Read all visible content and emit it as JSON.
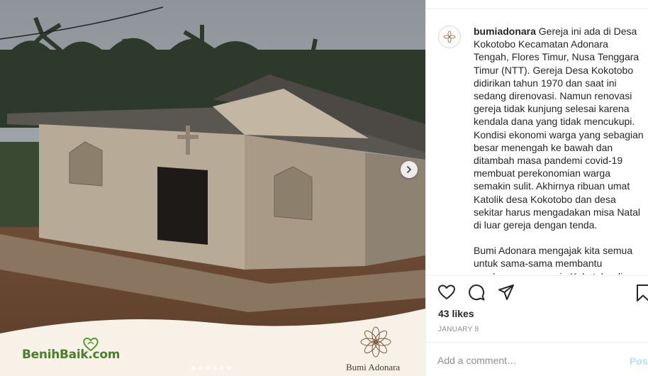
{
  "post": {
    "username": "bumiadonara",
    "caption_p1": "Gereja ini ada di Desa Kokotobo Kecamatan Adonara Tengah, Flores Timur, Nusa Tenggara Timur (NTT). Gereja Desa Kokotobo didirikan tahun 1970 dan saat ini sedang direnovasi. Namun renovasi gereja tidak kunjung selesai karena kendala dana yang tidak mencukupi. Kondisi ekonomi warga yang sebagian besar menengah ke bawah dan ditambah masa pandemi covid-19 membuat perekonomian warga semakin sulit. Akhirnya ribuan umat Katolik desa Kokotobo dan desa sekitar harus mengadakan misa Natal di luar gereja dengan tenda.",
    "caption_p2": "Bumi Adonara mengajak kita semua untuk sama-sama membantu pembangunan gereja Kokotobo di",
    "likes": "43 likes",
    "date": "JANUARY 8",
    "comment_placeholder": "Add a comment…",
    "post_label": "Post"
  },
  "image": {
    "brand_left": "BenihBaik",
    "brand_left_suffix": ".com",
    "brand_right": "Bumi Adonara",
    "carousel": {
      "count": 6,
      "active_index": 0
    }
  },
  "icons": {
    "like": "heart-icon",
    "comment": "comment-icon",
    "share": "paper-plane-icon",
    "save": "bookmark-icon",
    "next": "chevron-right-icon"
  },
  "colors": {
    "benih_green": "#4b7f2c",
    "post_button": "#b2dffc",
    "secondary_text": "#8e8e8e"
  }
}
